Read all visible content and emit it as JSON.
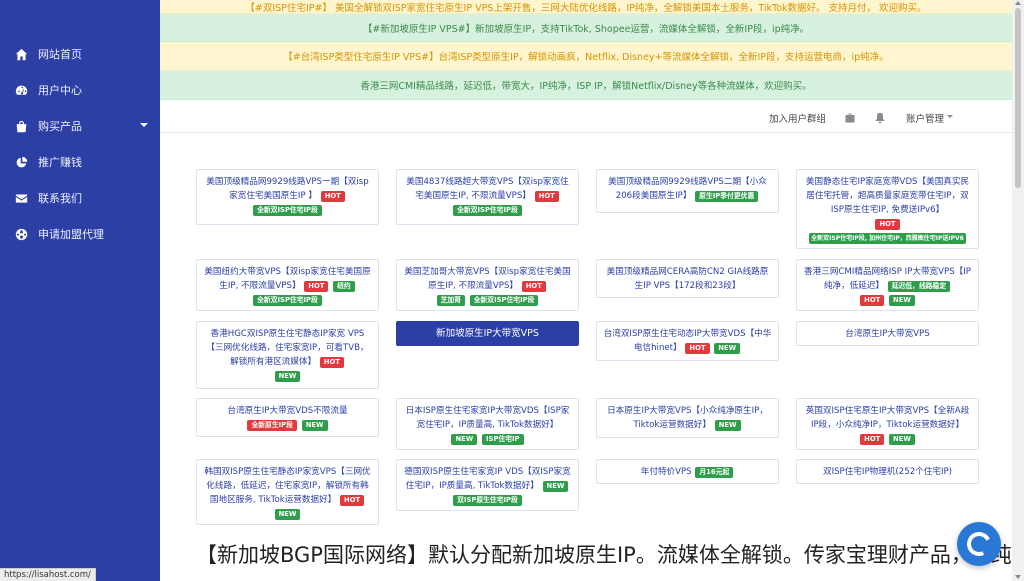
{
  "sidebar": {
    "items": [
      {
        "label": "网站首页",
        "icon": "home-icon"
      },
      {
        "label": "用户中心",
        "icon": "dashboard-icon"
      },
      {
        "label": "购买产品",
        "icon": "shopping-bag-icon",
        "has_caret": true
      },
      {
        "label": "推广赚钱",
        "icon": "pie-chart-icon"
      },
      {
        "label": "联系我们",
        "icon": "envelope-icon"
      },
      {
        "label": "申请加盟代理",
        "icon": "globe-icon"
      }
    ]
  },
  "notices": [
    "【#双ISP住宅IP#】 美国全解锁双ISP家宽住宅原生IP VPS上架开售，三网大陆优化线路，IP纯净，全解锁美国本土服务，TikTok数据好。 支持月付， 欢迎购买。",
    "【#新加坡原生IP VPS#】新加坡原生IP，支持TikTok, Shopee运营，流媒体全解锁，全新IP段，ip纯净。",
    "【#台湾ISP类型住宅原生IP VPS#】台湾ISP类型原生IP，解锁动画疯，Netflix, Disney+等流媒体全解锁，全新IP段，支持运营电商，ip纯净。",
    "香港三网CMI精品线路，延迟低，带宽大，IP纯净，ISP IP，解锁Netflix/Disney等各种流媒体，欢迎购买。"
  ],
  "topbar": {
    "join_group": "加入用户群组",
    "account": "账户管理"
  },
  "products": [
    {
      "title": "美国顶级精品网9929线路VPS一期【双isp家宽住宅美国原生IP 】",
      "badges": [
        "HOT",
        "全新双ISP住宅IP段"
      ]
    },
    {
      "title": "美国4837线路超大带宽VPS【双isp家宽住宅美国原生IP, 不限流量VPS】",
      "badges": [
        "HOT",
        "全新双ISP住宅IP段"
      ]
    },
    {
      "title": "美国顶级精品网9929线路VPS二期【小众206段美国原生IP】",
      "badges": [
        "原生IP季付更优惠"
      ]
    },
    {
      "title": "美国静态住宅IP家庭宽带VDS【美国真实民居住宅托管，超高质量家庭宽带住宅IP，双ISP原生住宅IP, 免费送IPv6】",
      "badges": [
        "HOT",
        "全新双ISP住宅IP段, 加州住宅IP，西雅图住宅IP送IPV6"
      ]
    },
    {
      "title": "美国纽约大带宽VPS【双isp家宽住宅美国原生IP, 不限流量VPS】",
      "badges": [
        "HOT",
        "纽约",
        "全新双ISP住宅IP段"
      ]
    },
    {
      "title": "美国芝加哥大带宽VPS【双isp家宽住宅美国原生IP, 不限流量VPS】",
      "badges": [
        "HOT",
        "芝加哥",
        "全新双ISP住宅IP段"
      ]
    },
    {
      "title": "美国顶级精品网CERA高防CN2 GIA线路原生IP VPS【172段和23段】",
      "badges": []
    },
    {
      "title": "香港三网CMI精品网络ISP IP大带宽VPS【IP纯净，低延迟】",
      "badges": [
        "延迟低，线路稳定",
        "HOT",
        "NEW"
      ]
    },
    {
      "title": "香港HGC双ISP原生住宅静态IP家宽 VPS【三网优化线路，住宅家宽IP，可看TVB，解锁所有港区流媒体】",
      "badges": [
        "HOT",
        "NEW"
      ]
    },
    {
      "title": "新加坡原生IP大带宽VPS",
      "badges": []
    },
    {
      "title": "台湾双ISP原生住宅动态IP大带宽VDS【中华电信hinet】",
      "badges": [
        "HOT",
        "NEW"
      ]
    },
    {
      "title": "台湾原生IP大带宽VPS",
      "badges": []
    },
    {
      "title": "台湾原生IP大带宽VDS不限流量",
      "badges": [
        "全新原生IP段",
        "NEW"
      ]
    },
    {
      "title": "日本ISP原生住宅家宽IP大带宽VDS【ISP家宽住宅IP，IP质量高, TikTok数据好】",
      "badges": [
        "NEW",
        "ISP住宅IP"
      ]
    },
    {
      "title": "日本原生IP大带宽VPS【小众纯净原生IP，Tiktok运营数据好】",
      "badges": [
        "NEW"
      ]
    },
    {
      "title": "英国双ISP住宅原生IP大带宽VPS【全新A段IP段，小众纯净IP，Tiktok运营数据好】",
      "badges": [
        "HOT",
        "NEW"
      ]
    },
    {
      "title": "韩国双ISP原生住宅静态IP家宽VPS【三网优化线路，低延迟，住宅家宽IP，解锁所有韩国地区服务, TikTok运营数据好】",
      "badges": [
        "HOT",
        "NEW"
      ]
    },
    {
      "title": "德国双ISP原生住宅家宽IP VDS【双ISP家宽住宅IP，IP质量高, TikTok数据好】",
      "badges": [
        "NEW",
        "双ISP原生住宅IP段"
      ]
    },
    {
      "title": "年付特价VPS",
      "badges": [
        "月16元起"
      ]
    },
    {
      "title": "双ISP住宅IP物理机(252个住宅IP)",
      "badges": []
    }
  ],
  "big_text": "【新加坡BGP国际网络】默认分配新加坡原生IP。流媒体全解锁。传家宝理财产品，IP纯净，Cl，超大带宽，NVMe高性能固态硬盘，读写速度快，支持TikTok",
  "status_url": "https://lisahost.com/",
  "colors": {
    "sidebar": "#2b3fa5",
    "hot": "#e03a3e",
    "new": "#2e9e4a"
  }
}
